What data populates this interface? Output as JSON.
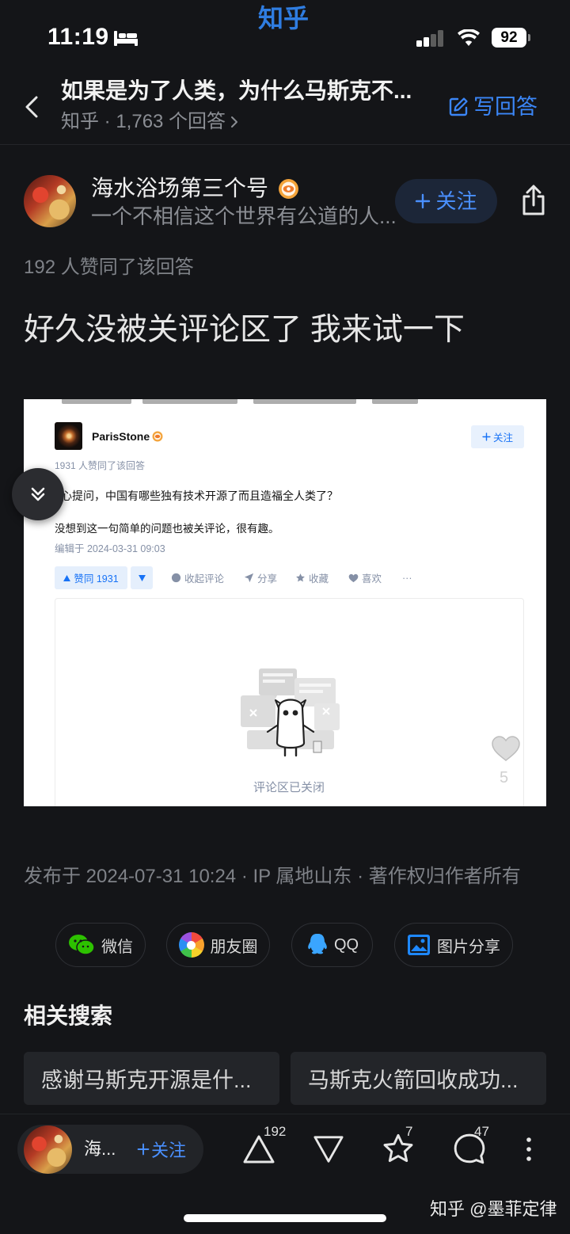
{
  "theme": {
    "background": "#141518",
    "accent": "#3b86f7",
    "zhihu_blue": "#1772f6",
    "wechat_green": "#2dc100"
  },
  "status_bar": {
    "time": "11:19",
    "battery": "92",
    "app_watermark": "知乎",
    "icons": [
      "bed-icon",
      "signal-icon",
      "wifi-icon",
      "battery-icon"
    ]
  },
  "header": {
    "title": "如果是为了人类，为什么马斯克不...",
    "subtitle": "知乎 · 1,763 个回答",
    "write_answer": "写回答"
  },
  "author": {
    "name": "海水浴场第三个号",
    "bio": "一个不相信这个世界有公道的人...",
    "follow": "关注"
  },
  "answer": {
    "upvote_summary": "192 人赞同了该回答",
    "text": "好久没被关评论区了 我来试一下",
    "image_likes": "5",
    "published": "发布于 2024-07-31 10:24 · IP 属地山东 · 著作权归作者所有",
    "embedded_screenshot": {
      "author": "ParisStone",
      "follow": "关注",
      "upvote_summary": "1931 人赞同了该回答",
      "lines": [
        "心提问，中国有哪些独有技术开源了而且造福全人类了？",
        "没想到这一句简单的问题也被关评论，很有趣。"
      ],
      "edited": "编辑于 2024-03-31 09:03",
      "vote_label": "赞同 1931",
      "actions": [
        "收起评论",
        "分享",
        "收藏",
        "喜欢",
        "···"
      ],
      "comments_closed": "评论区已关闭"
    }
  },
  "share": {
    "items": [
      {
        "label": "微信",
        "icon": "wechat-icon"
      },
      {
        "label": "朋友圈",
        "icon": "moments-icon"
      },
      {
        "label": "QQ",
        "icon": "qq-icon"
      },
      {
        "label": "图片分享",
        "icon": "image-share-icon"
      }
    ]
  },
  "related": {
    "title": "相关搜索",
    "items": [
      "感谢马斯克开源是什...",
      "马斯克火箭回收成功..."
    ]
  },
  "bottom_bar": {
    "author_short": "海...",
    "follow": "关注",
    "upvotes": "192",
    "favorites": "7",
    "comments": "47"
  },
  "watermark": "知乎 @墨菲定律"
}
